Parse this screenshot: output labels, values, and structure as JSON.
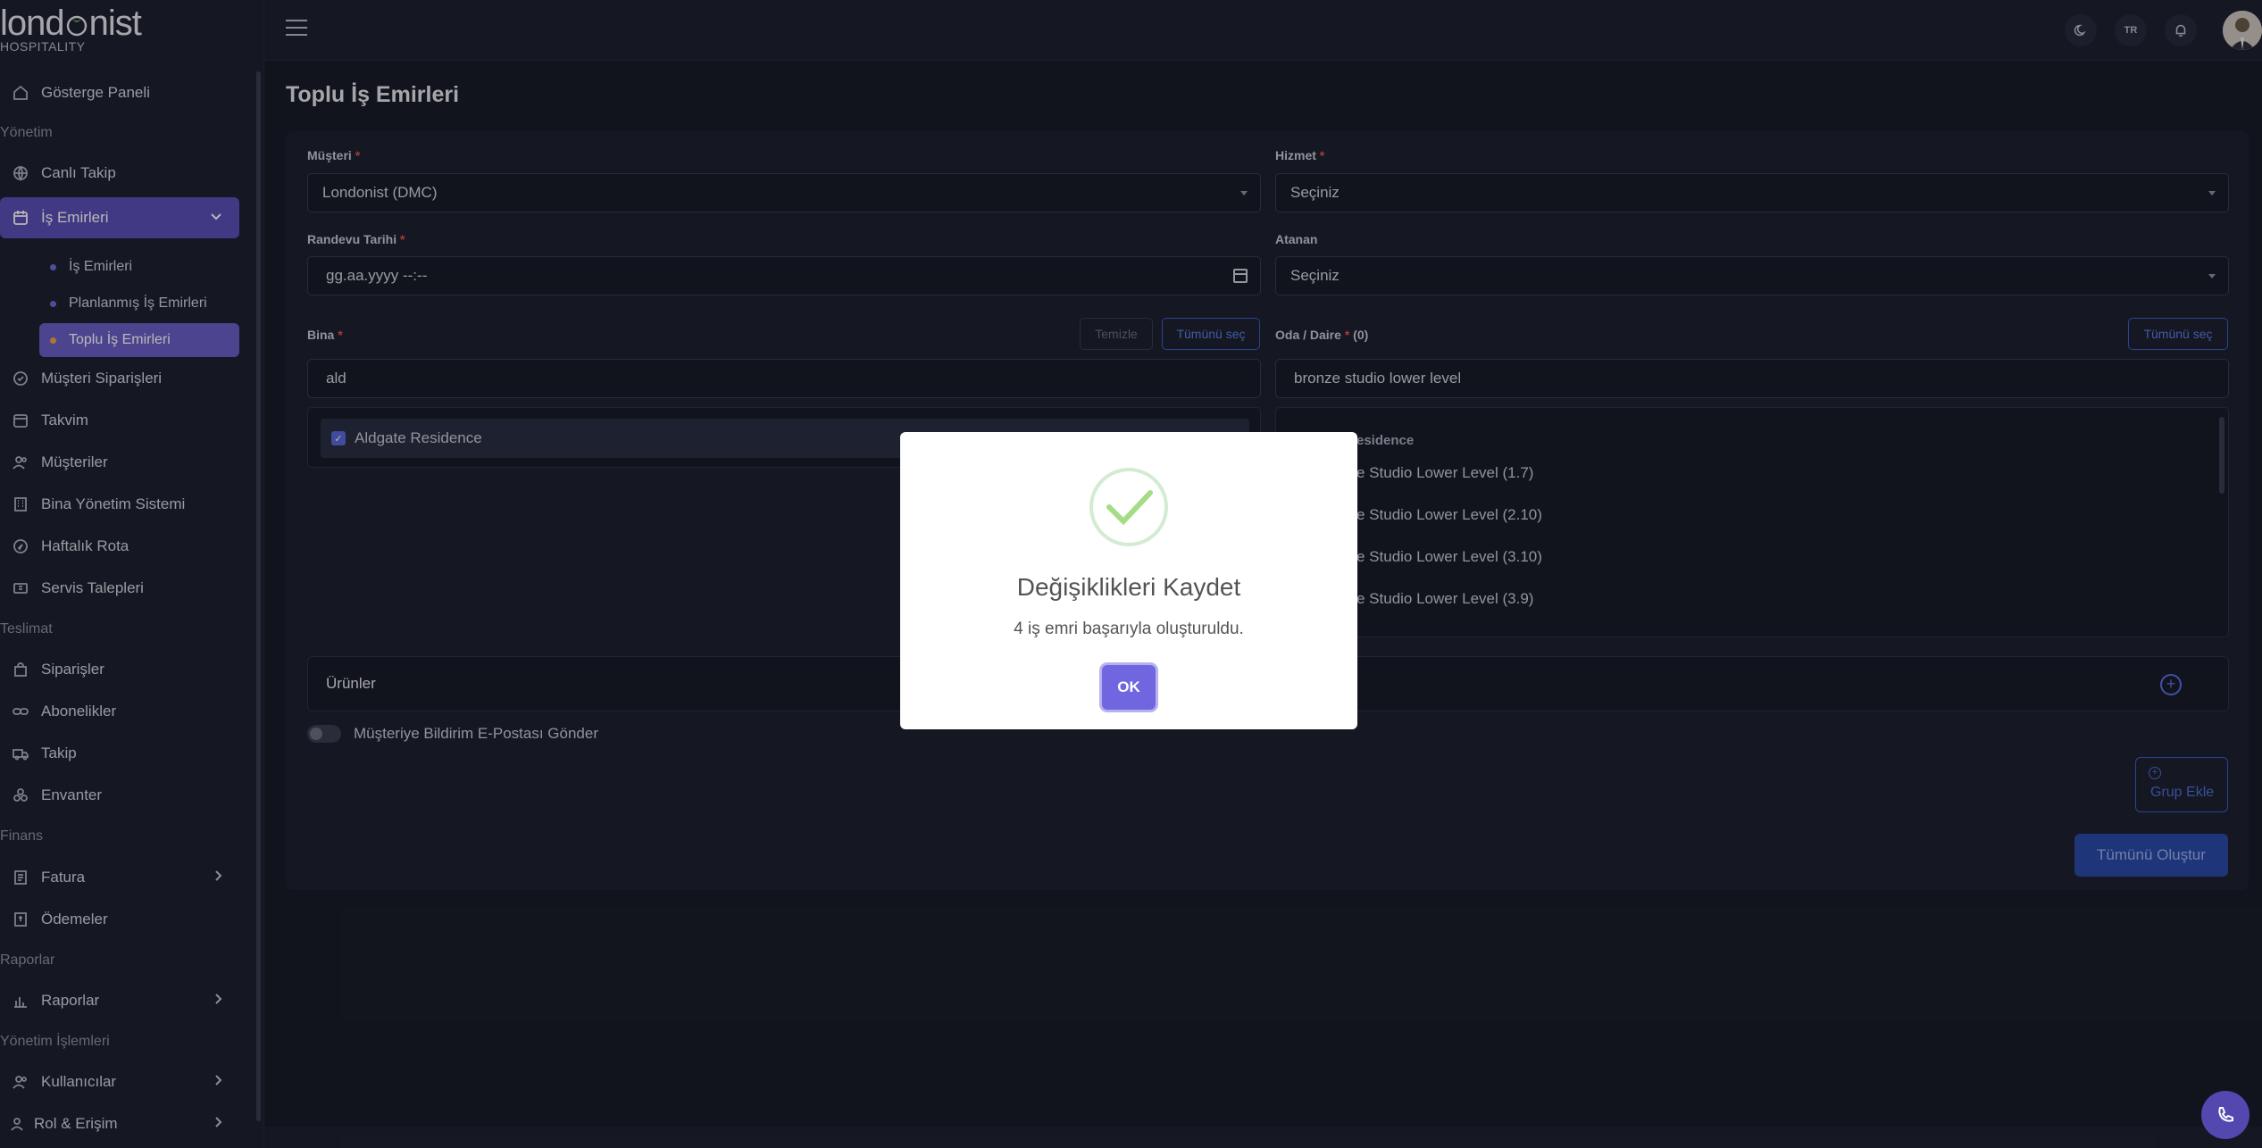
{
  "brand": {
    "logo_left": "lond",
    "logo_right": "nist",
    "logo_sub": "HOSPITALITY"
  },
  "sidebar": {
    "dashboard": "Gösterge Paneli",
    "section_management": "Yönetim",
    "live_tracking": "Canlı Takip",
    "work_orders": "İş Emirleri",
    "sub_work_orders": "İş Emirleri",
    "sub_planned": "Planlanmış İş Emirleri",
    "sub_bulk": "Toplu İş Emirleri",
    "customer_orders": "Müşteri Siparişleri",
    "calendar": "Takvim",
    "customers": "Müşteriler",
    "building_mgmt": "Bina Yönetim Sistemi",
    "weekly_route": "Haftalık Rota",
    "service_requests": "Servis Talepleri",
    "section_delivery": "Teslimat",
    "orders": "Siparişler",
    "subscriptions": "Abonelikler",
    "tracking": "Takip",
    "inventory": "Envanter",
    "section_finance": "Finans",
    "invoice": "Fatura",
    "payments": "Ödemeler",
    "section_reports": "Raporlar",
    "reports": "Raporlar",
    "section_admin": "Yönetim İşlemleri",
    "users": "Kullanıcılar",
    "roles": "Rol & Erişim"
  },
  "topbar": {
    "lang": "TR"
  },
  "page": {
    "title": "Toplu İş Emirleri"
  },
  "form": {
    "customer_label": "Müşteri",
    "customer_value": "Londonist (DMC)",
    "service_label": "Hizmet",
    "service_value": "Seçiniz",
    "date_label": "Randevu Tarihi",
    "date_value": "gg.aa.yyyy --:--",
    "assignee_label": "Atanan",
    "assignee_value": "Seçiniz",
    "building_label": "Bina",
    "clear_btn": "Temizle",
    "select_all_btn": "Tümünü seç",
    "building_search": "ald",
    "building_option": "Aldgate Residence",
    "room_label": "Oda / Daire",
    "room_count": "(0)",
    "room_select_all_btn": "Tümünü seç",
    "room_search": "bronze studio lower level",
    "room_group": "esidence",
    "rooms": [
      "e Studio Lower Level (1.7)",
      "e Studio Lower Level (2.10)",
      "e Studio Lower Level (3.10)",
      "e Studio Lower Level (3.9)"
    ],
    "products_title": "Ürünler",
    "notify_label": "Müşteriye Bildirim E-Postası Gönder",
    "add_group_btn": "Grup Ekle",
    "create_all_btn": "Tümünü Oluştur"
  },
  "modal": {
    "title": "Değişiklikleri Kaydet",
    "message": "4 iş emri başarıyla oluşturuldu.",
    "ok": "OK"
  },
  "colors": {
    "accent": "#5a4fb8",
    "success": "#a5dc86",
    "ok_button": "#7066e0"
  }
}
